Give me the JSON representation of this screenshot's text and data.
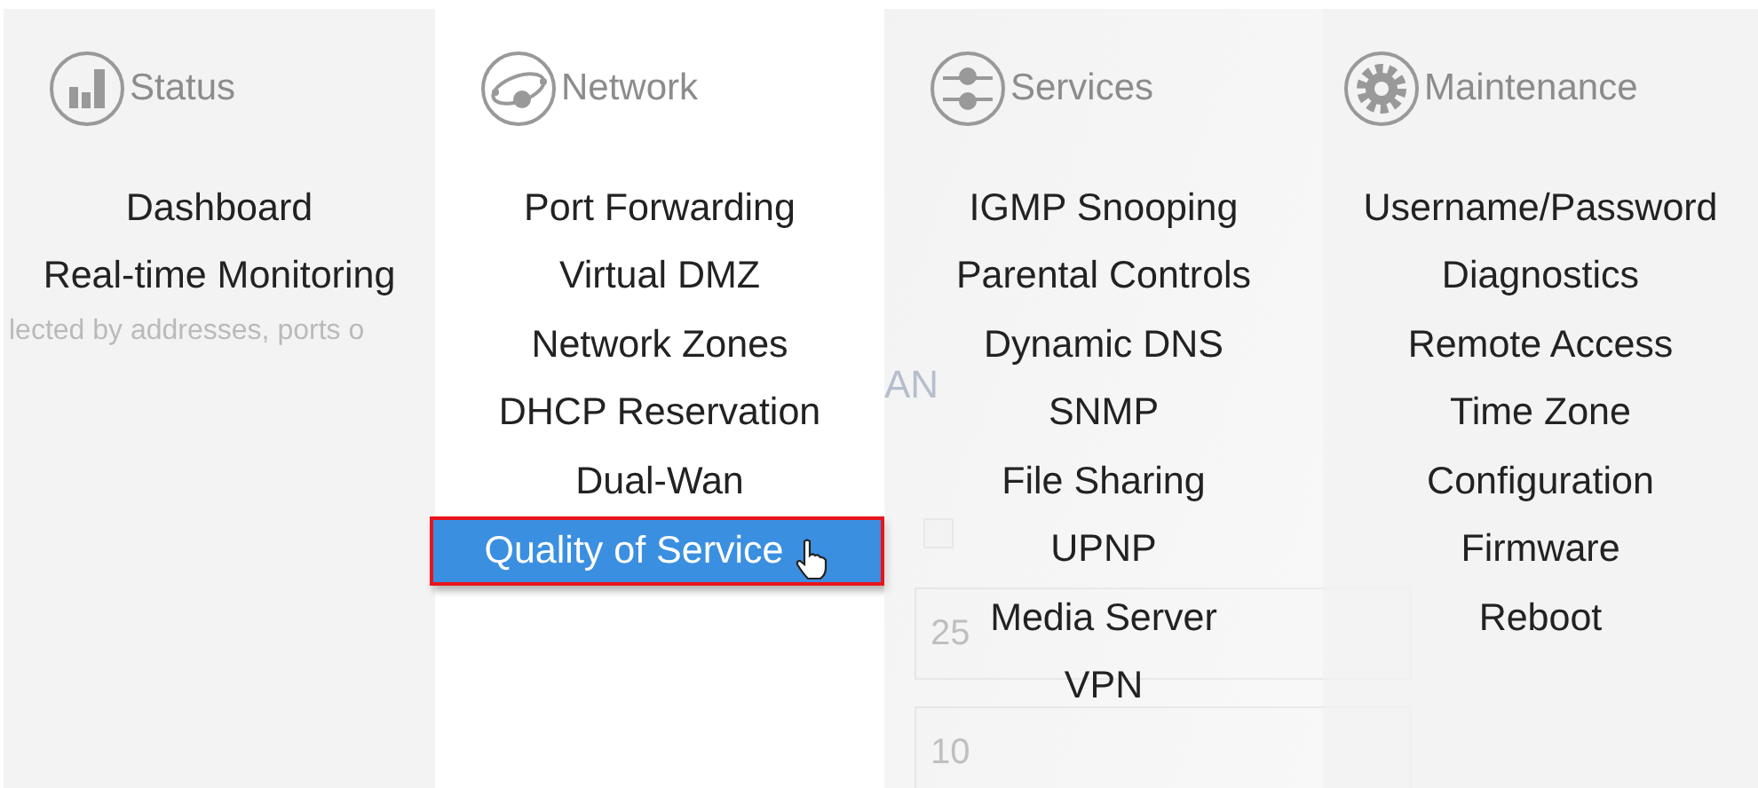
{
  "background_page": {
    "description_text": "lected by addresses, ports o",
    "heading_fragment": "AN",
    "checkbox": {
      "checked": false
    },
    "fields": [
      {
        "value": "25"
      },
      {
        "value": "10"
      }
    ]
  },
  "menu": {
    "columns": [
      {
        "title": "Status",
        "kind": "status",
        "items": [
          {
            "label": "Dashboard",
            "selected": false
          },
          {
            "label": "Real-time Monitoring",
            "selected": false
          }
        ]
      },
      {
        "title": "Network",
        "kind": "network",
        "items": [
          {
            "label": "Port Forwarding",
            "selected": false
          },
          {
            "label": "Virtual DMZ",
            "selected": false
          },
          {
            "label": "Network Zones",
            "selected": false
          },
          {
            "label": "DHCP Reservation",
            "selected": false
          },
          {
            "label": "Dual-Wan",
            "selected": false
          },
          {
            "label": "Quality of Service",
            "selected": true
          }
        ]
      },
      {
        "title": "Services",
        "kind": "services",
        "items": [
          {
            "label": "IGMP Snooping",
            "selected": false
          },
          {
            "label": "Parental Controls",
            "selected": false
          },
          {
            "label": "Dynamic DNS",
            "selected": false
          },
          {
            "label": "SNMP",
            "selected": false
          },
          {
            "label": "File Sharing",
            "selected": false
          },
          {
            "label": "UPNP",
            "selected": false
          },
          {
            "label": "Media Server",
            "selected": false
          },
          {
            "label": "VPN",
            "selected": false
          }
        ]
      },
      {
        "title": "Maintenance",
        "kind": "maintenance",
        "items": [
          {
            "label": "Username/Password",
            "selected": false
          },
          {
            "label": "Diagnostics",
            "selected": false
          },
          {
            "label": "Remote Access",
            "selected": false
          },
          {
            "label": "Time Zone",
            "selected": false
          },
          {
            "label": "Configuration",
            "selected": false
          },
          {
            "label": "Firmware",
            "selected": false
          },
          {
            "label": "Reboot",
            "selected": false
          }
        ]
      }
    ]
  }
}
